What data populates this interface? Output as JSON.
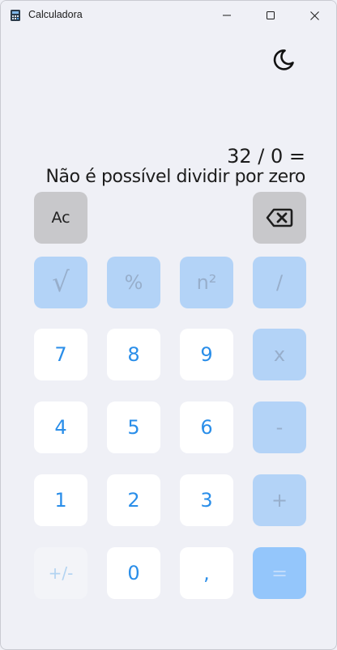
{
  "window": {
    "title": "Calculadora"
  },
  "display": {
    "expression": "32 / 0 =",
    "result": "Não é possível dividir por zero"
  },
  "keys": {
    "clear": "Ac",
    "sqrt": "√",
    "percent": "%",
    "square": "n²",
    "divide": "/",
    "seven": "7",
    "eight": "8",
    "nine": "9",
    "multiply": "x",
    "four": "4",
    "five": "5",
    "six": "6",
    "minus": "-",
    "one": "1",
    "two": "2",
    "three": "3",
    "plus": "+",
    "negate": "+/-",
    "zero": "0",
    "decimal": ",",
    "equals": "="
  },
  "icons": {
    "app": "calculator-icon",
    "theme": "moon-icon",
    "backspace": "backspace-icon"
  },
  "colors": {
    "background": "#eff0f6",
    "number_key": "#ffffff",
    "number_text": "#2a8ee9",
    "operator_key": "#b3d3f7",
    "equals_key": "#94c6fb",
    "gray_key": "#c8c8cb"
  }
}
